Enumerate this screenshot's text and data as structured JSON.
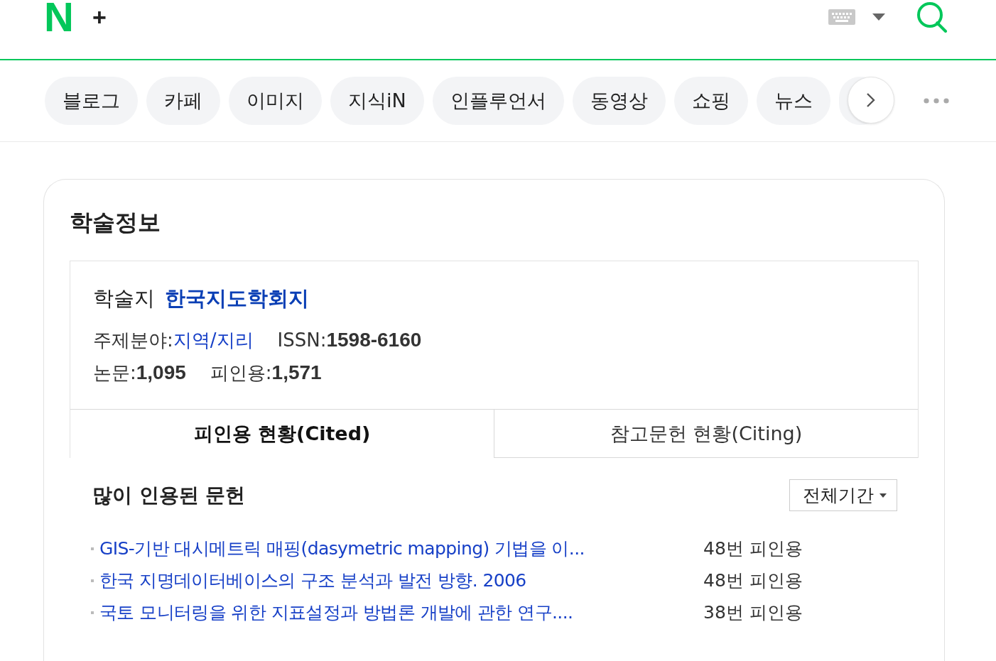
{
  "header": {
    "logo": "N",
    "add_button": "+"
  },
  "categories": [
    {
      "label": "블로그"
    },
    {
      "label": "카페"
    },
    {
      "label": "이미지"
    },
    {
      "label": "지식iN"
    },
    {
      "label": "인플루언서"
    },
    {
      "label": "동영상"
    },
    {
      "label": "쇼핑"
    },
    {
      "label": "뉴스"
    }
  ],
  "section": {
    "title": "학술정보",
    "journal": {
      "label": "학술지",
      "name": "한국지도학회지",
      "field_label": "주제분야:",
      "field": "지역/지리",
      "issn_label": "ISSN:",
      "issn": "1598-6160",
      "papers_label": "논문:",
      "papers": "1,095",
      "cited_label": "피인용:",
      "cited": "1,571"
    },
    "tabs": [
      {
        "label": "피인용 현황(Cited)",
        "selected": true
      },
      {
        "label": "참고문헌 현황(Citing)",
        "selected": false
      }
    ],
    "list_title": "많이 인용된 문헌",
    "period": "전체기간",
    "papers": [
      {
        "title": "GIS-기반 대시메트릭 매핑(dasymetric mapping) 기법을 이...",
        "count": "48번 피인용"
      },
      {
        "title": "한국 지명데이터베이스의 구조 분석과 발전 방향. 2006",
        "count": "48번 피인용"
      },
      {
        "title": "국토 모니터링을 위한 지표설정과 방법론 개발에 관한 연구....",
        "count": "38번 피인용"
      }
    ]
  }
}
